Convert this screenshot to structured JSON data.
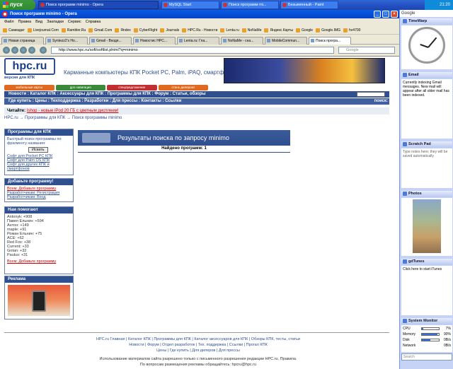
{
  "taskbar": {
    "start_label": "пуск",
    "buttons": [
      {
        "label": "Поиск программ minimo - Opera",
        "active": true
      },
      {
        "label": "MySQL Start",
        "active": false
      },
      {
        "label": "Поиск программ mi...",
        "active": false
      },
      {
        "label": "Безымянный - Paint",
        "active": false
      }
    ],
    "clock": "21:20"
  },
  "browser": {
    "title": "Поиск программ minimo - Opera",
    "menu": [
      "Файл",
      "Правка",
      "Вид",
      "Закладки",
      "Сервис",
      "Справка"
    ],
    "bookmarks": [
      "Самиздат",
      "Livejournal.Com",
      "Rambler.Ru",
      "Gmail.Com",
      "Яndex",
      "CyberFlight",
      "Journals",
      "HPC.Ru - Новости",
      "Lenta.ru",
      "NoNaMe",
      "Яндекс.Карты",
      "Google",
      "Google.IMG",
      "hv4700"
    ],
    "tabs": [
      {
        "label": "Новая страница",
        "active": false
      },
      {
        "label": "Syntezz2's Ho...",
        "active": false
      },
      {
        "label": "Gmail - Входя...",
        "active": false
      },
      {
        "label": "Новостис HPC...",
        "active": false
      },
      {
        "label": "Lenta.ru: Гла...",
        "active": false
      },
      {
        "label": "NoNaMe - сна...",
        "active": false
      },
      {
        "label": "MobileCommun...",
        "active": false
      },
      {
        "label": "Поиск програ...",
        "active": true
      }
    ],
    "address": "http://www.hpc.ru/soft/softlist.phtml?q=minimo",
    "search_placeholder": "Google"
  },
  "site": {
    "logo_text": "hpc.ru",
    "logo_sub": "версия для КПК",
    "slogan": "Карманные компьютеры КПК Pocket PC, Palm, iPAQ, смартфоны",
    "promo": [
      "мобильные карты",
      "gps навигация",
      "спецпредложение",
      "стань дилером!"
    ],
    "nav1": "Новости : Каталог КПК : Аксессуары для КПК : Программы для КПК : Форум : Статьи, обзоры",
    "nav2": "Где купить : Цены : Техподдержка : Разработки : Для прессы : Контакты : Ссылки",
    "nav_search_label": "поиск:",
    "reading_label": "Читайте:",
    "reading_link": "Ishop - новые iPod 20 ГБ с цветным дисплеем!",
    "crumbs": "HPC.ru → Программы для КПК → Поиск программы minimo",
    "boxes": {
      "programs": {
        "title": "Программы для КПК",
        "desc": "Быстрый поиск программы по фрагменту названия:",
        "button": "Искать",
        "links": [
          "Софт для Pocket PC КПК",
          "Софт для Palm OS КПК",
          "Софт для других КПК и смартфонов"
        ]
      },
      "add": {
        "title": "Добавьте программу!",
        "links": [
          "Всем: Добавьте программу",
          "Разработчикам: Регистрация",
          "Разработчикам: Вход"
        ]
      },
      "helpers": {
        "title": "Нам помогают",
        "rows": [
          "Antonyk: +908",
          "Павел Ельнин: +594",
          "Антон: +149",
          "maple: +91",
          "Роман Ельнин: +75",
          "ACE: +62",
          "Red Fox: +38",
          "Current: +33",
          "Gotan: +32",
          "Paulus: +31"
        ],
        "link": "Всем: Добавьте программу"
      },
      "ads": {
        "title": "Реклама"
      }
    },
    "results_title": "Результаты поиска по запросу minimo",
    "found": "Найдено программ: 1",
    "footer1": "HPC.ru Главная | Каталог КПК | Программы для КПК | Каталог аксессуаров для КПК | Обзоры КПК, тесты, статьи",
    "footer2": "Новости | Форум | Отдел разработок | Тех. поддержка | Ссылки | Прогал КПК",
    "footer3": "Цены | Где купить | Для дилеров | Для прессы",
    "copyright": "Использование материалов сайта разрешено только с письменного разрешения редакции HPC.ru. Правила.",
    "copyright2": "По вопросам размещения рекламы обращайтесь: hpcru@hpc.ru"
  },
  "sidebar": {
    "header": "Google",
    "gadgets": {
      "timewarp": "TimeWarp",
      "email": "Email",
      "email_text": "Currently indexing Gmail messages. New mail will appear after all older mail has been indexed.",
      "scratch": "Scratch Pad",
      "scratch_text": "Type notes here; they will be saved automatically",
      "photos": "Photos",
      "itunes": "gdTunes",
      "itunes_text": "Click here to start iTunes",
      "sysmon": "System Monitor"
    },
    "metrics": [
      {
        "label": "CPU",
        "value": "7%",
        "fraction": 0.07
      },
      {
        "label": "Memory",
        "value": "90%",
        "fraction": 0.9
      },
      {
        "label": "Disk",
        "value": "0B/s",
        "fraction": 0.5
      },
      {
        "label": "Network",
        "value": "0B/s",
        "fraction": 0.0
      }
    ],
    "search_placeholder": "Search"
  }
}
